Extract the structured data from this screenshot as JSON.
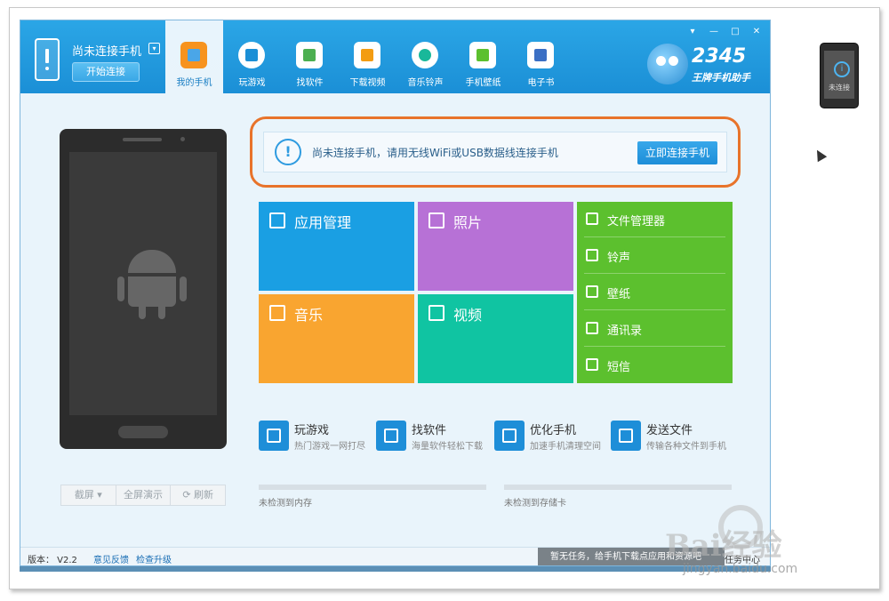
{
  "window": {
    "controls": [
      "▾",
      "—",
      "□",
      "✕"
    ]
  },
  "connection": {
    "status": "尚未连接手机",
    "dropdown": "▾",
    "connect_button": "开始连接"
  },
  "nav": {
    "items": [
      {
        "label": "我的手机",
        "active": true
      },
      {
        "label": "玩游戏"
      },
      {
        "label": "找软件"
      },
      {
        "label": "下载视频"
      },
      {
        "label": "音乐铃声"
      },
      {
        "label": "手机壁纸"
      },
      {
        "label": "电子书"
      }
    ]
  },
  "logo": {
    "number": "2345",
    "tagline": "王牌手机助手"
  },
  "alert": {
    "icon": "!",
    "message": "尚未连接手机，请用无线WiFi或USB数据线连接手机",
    "button": "立即连接手机"
  },
  "tiles": {
    "app": "应用管理",
    "photo": "照片",
    "music": "音乐",
    "video": "视频"
  },
  "side_menu": [
    "文件管理器",
    "铃声",
    "壁纸",
    "通讯录",
    "短信"
  ],
  "quick": [
    {
      "title": "玩游戏",
      "subtitle": "热门游戏一网打尽"
    },
    {
      "title": "找软件",
      "subtitle": "海量软件轻松下载"
    },
    {
      "title": "优化手机",
      "subtitle": "加速手机清理空间"
    },
    {
      "title": "发送文件",
      "subtitle": "传输各种文件到手机"
    }
  ],
  "phone_tools": {
    "screenshot": "截屏 ▾",
    "fullscreen": "全屏演示",
    "refresh": "⟳ 刷新"
  },
  "storage": {
    "memory": "未检测到内存",
    "sdcard": "未检测到存储卡"
  },
  "status_bar": {
    "version": "版本： V2.2",
    "feedback": "意见反馈",
    "upgrade": "检查升级",
    "task_text": "暂无任务，给手机下载点应用和资源吧",
    "task_center": "任务中心"
  },
  "mini_phone": {
    "icon": "i",
    "label": "未连接"
  },
  "watermark": {
    "brand": "Bai经验",
    "url": "jingyan.baidu.com"
  },
  "colors": {
    "topbar": "#1b8fd6",
    "alert_border": "#e8732a",
    "tile_app": "#1a9fe3",
    "tile_photo": "#b771d6",
    "tile_music": "#f9a530",
    "tile_video": "#10c4a2",
    "tile_side": "#5cc02e"
  }
}
